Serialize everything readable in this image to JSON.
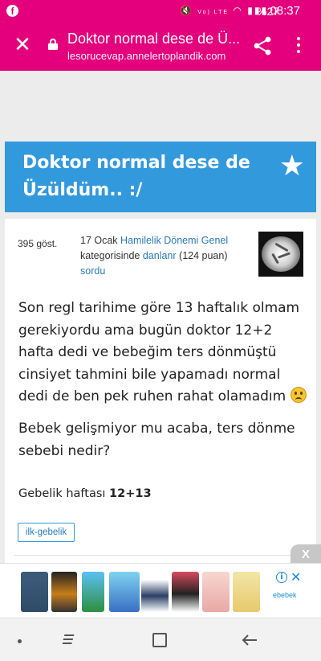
{
  "status_bar": {
    "app_icon": "facebook-icon",
    "icons": "mute wifi signal",
    "volte": "Vo) LTE",
    "battery": "%27",
    "time": "08:37"
  },
  "browser": {
    "page_title": "Doktor normal dese de Ü...",
    "url": "lesorucevap.annelertoplandik.com"
  },
  "question": {
    "title": "Doktor normal dese de Üzüldüm.. :/",
    "views": "395 göst.",
    "date": "17 Ocak",
    "category": "Hamilelik Dönemi Genel",
    "category_suffix": "kategorisinde",
    "author": "danlanr",
    "points": "(124 puan)",
    "asked": "sordu",
    "body_paragraph_1": "Son regl tarihime göre 13 haftalık olmam gerekiyordu ama bugün doktor 12+2 hafta dedi ve bebeğim ters dönmüştü cinsiyet tahmini bile yapamadı normal dedi de ben pek ruhen rahat olamadım",
    "body_paragraph_2": "Bebek gelişmiyor mu acaba, ters dönme sebebi nedir?",
    "week_label": "Gebelik haftası",
    "week_value": "12+13",
    "tag": "ilk-gebelik"
  },
  "ad": {
    "close_label": "X",
    "brand": "ebebek"
  },
  "colors": {
    "brand_pink": "#e4007c",
    "header_blue": "#3399dd",
    "link_blue": "#2a7ab8"
  }
}
